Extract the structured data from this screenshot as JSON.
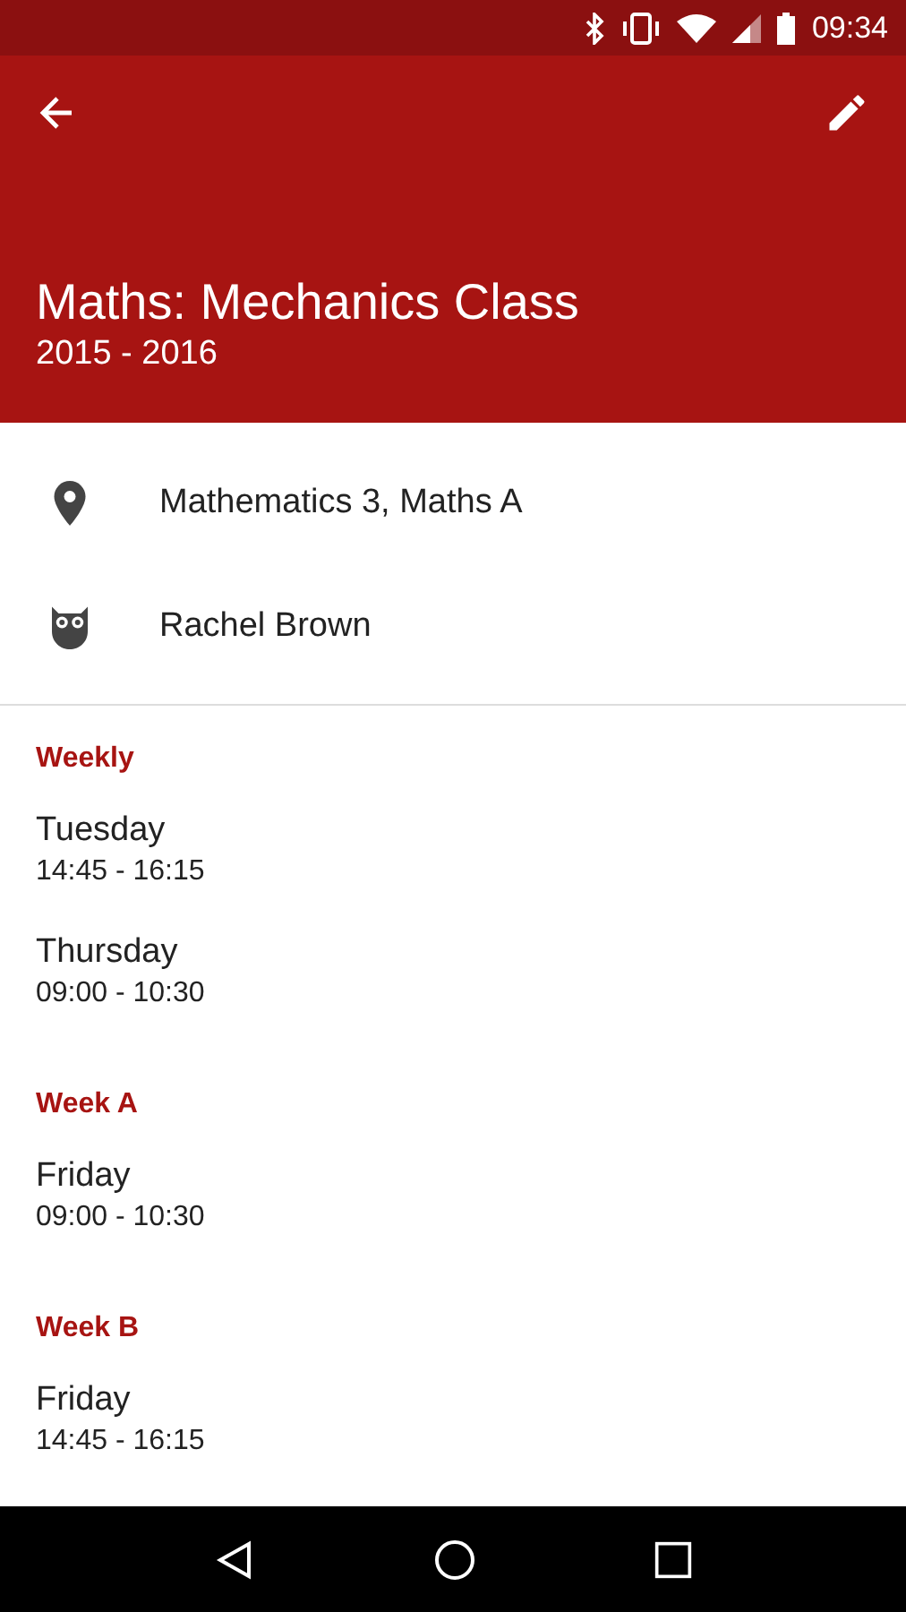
{
  "status_bar": {
    "time": "09:34"
  },
  "header": {
    "title": "Maths: Mechanics Class",
    "subtitle": "2015 - 2016"
  },
  "details": [
    {
      "kind": "location",
      "text": "Mathematics 3, Maths A"
    },
    {
      "kind": "teacher",
      "text": "Rachel Brown"
    }
  ],
  "schedule": [
    {
      "heading": "Weekly",
      "entries": [
        {
          "day": "Tuesday",
          "time": "14:45 - 16:15"
        },
        {
          "day": "Thursday",
          "time": "09:00 - 10:30"
        }
      ]
    },
    {
      "heading": "Week A",
      "entries": [
        {
          "day": "Friday",
          "time": "09:00 - 10:30"
        }
      ]
    },
    {
      "heading": "Week B",
      "entries": [
        {
          "day": "Friday",
          "time": "14:45 - 16:15"
        }
      ]
    }
  ]
}
